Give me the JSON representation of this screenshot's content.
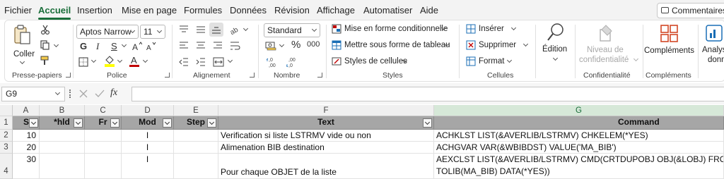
{
  "menu": {
    "tabs": [
      "Fichier",
      "Accueil",
      "Insertion",
      "Mise en page",
      "Formules",
      "Données",
      "Révision",
      "Affichage",
      "Automatiser",
      "Aide"
    ],
    "active": "Accueil",
    "comments_label": "Commentaires"
  },
  "ribbon": {
    "clipboard": {
      "paste_label": "Coller",
      "group_label": "Presse-papiers"
    },
    "font": {
      "family": "Aptos Narrow",
      "size": "11",
      "bold": "G",
      "italic": "I",
      "underline": "S",
      "font_color_glyph": "A",
      "group_label": "Police"
    },
    "alignment": {
      "group_label": "Alignement"
    },
    "number": {
      "format": "Standard",
      "percent": "%",
      "thousands": "000",
      "inc_decimals": ",0\n,00",
      "dec_decimals": ",00\n,0",
      "group_label": "Nombre"
    },
    "styles": {
      "conditional_label": "Mise en forme conditionnelle",
      "table_label": "Mettre sous forme de tableau",
      "cell_styles_label": "Styles de cellules",
      "group_label": "Styles"
    },
    "cells": {
      "insert_label": "Insérer",
      "delete_label": "Supprimer",
      "format_label": "Format",
      "group_label": "Cellules"
    },
    "editing": {
      "label": "Édition"
    },
    "sensitivity": {
      "label_line1": "Niveau de",
      "label_line2": "confidentialité",
      "group_label": "Confidentialité"
    },
    "addins": {
      "label": "Compléments",
      "group_label": "Compléments"
    },
    "analysis": {
      "label_line1": "Analys",
      "label_line2": "donn"
    }
  },
  "formula_bar": {
    "name_box": "G9",
    "fx": "fx",
    "value": ""
  },
  "sheet": {
    "columns": [
      "A",
      "B",
      "C",
      "D",
      "E",
      "F",
      "G"
    ],
    "selected_column": "G",
    "rows": [
      "1",
      "2",
      "3",
      "4"
    ],
    "header": [
      "Seq",
      "*hld",
      "Fr",
      "Mod",
      "Step",
      "Text",
      "Command"
    ],
    "data": [
      [
        "10",
        "",
        "",
        "I",
        "",
        "Verification si liste LSTRMV vide ou non",
        "ACHKLST LIST(&AVERLIB/LSTRMV) CHKELEM(*YES)"
      ],
      [
        "20",
        "",
        "",
        "I",
        "",
        "Alimenation BIB destination",
        "ACHGVAR VAR(&WBIBDST) VALUE('MA_BIB')"
      ],
      [
        "30",
        "",
        "",
        "I",
        "",
        "Pour chaque OBJET de la liste",
        "AEXCLST LIST(&AVERLIB/LSTRMV) CMD(CRTDUPOBJ OBJ(&LOBJ) FROMLIB(&AV",
        "TOLIB(MA_BIB) DATA(*YES))"
      ]
    ]
  },
  "colors": {
    "accent": "#1a6e3a",
    "header_fill": "#a6a6a6",
    "font_red": "#c00000",
    "highlight_yellow": "#ffff00"
  }
}
